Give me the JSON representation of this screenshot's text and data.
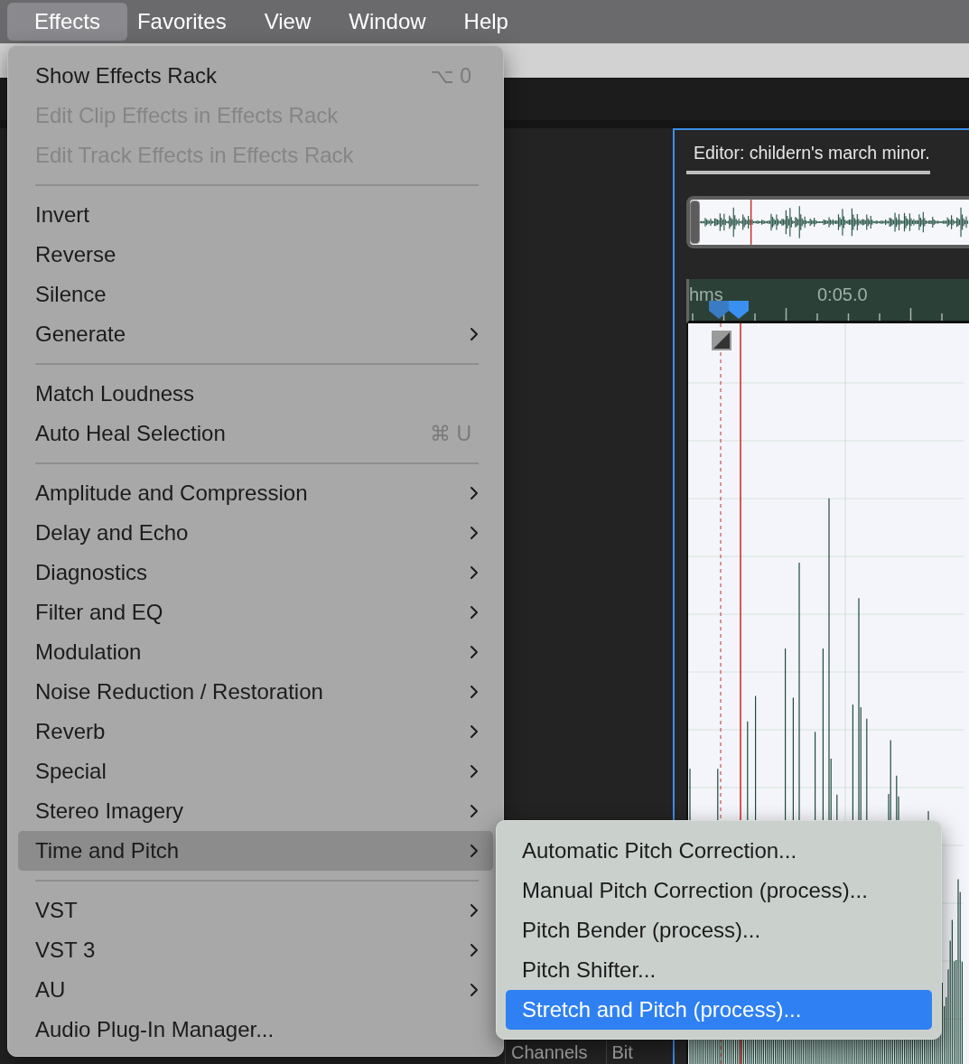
{
  "menu_bar": {
    "items": [
      {
        "label": "Effects",
        "selected": true
      },
      {
        "label": "Favorites",
        "selected": false
      },
      {
        "label": "View",
        "selected": false
      },
      {
        "label": "Window",
        "selected": false
      },
      {
        "label": "Help",
        "selected": false
      }
    ]
  },
  "effects_menu": {
    "items": [
      {
        "kind": "item",
        "label": "Show Effects Rack",
        "shortcut": "⌥ 0",
        "disabled": false,
        "submenu": false,
        "selected": false
      },
      {
        "kind": "item",
        "label": "Edit Clip Effects in Effects Rack",
        "disabled": true,
        "submenu": false,
        "selected": false
      },
      {
        "kind": "item",
        "label": "Edit Track Effects in Effects Rack",
        "disabled": true,
        "submenu": false,
        "selected": false
      },
      {
        "kind": "separator"
      },
      {
        "kind": "item",
        "label": "Invert",
        "disabled": false,
        "submenu": false,
        "selected": false
      },
      {
        "kind": "item",
        "label": "Reverse",
        "disabled": false,
        "submenu": false,
        "selected": false
      },
      {
        "kind": "item",
        "label": "Silence",
        "disabled": false,
        "submenu": false,
        "selected": false
      },
      {
        "kind": "item",
        "label": "Generate",
        "disabled": false,
        "submenu": true,
        "selected": false
      },
      {
        "kind": "separator"
      },
      {
        "kind": "item",
        "label": "Match Loudness",
        "disabled": false,
        "submenu": false,
        "selected": false
      },
      {
        "kind": "item",
        "label": "Auto Heal Selection",
        "shortcut": "⌘ U",
        "disabled": false,
        "submenu": false,
        "selected": false
      },
      {
        "kind": "separator"
      },
      {
        "kind": "item",
        "label": "Amplitude and Compression",
        "disabled": false,
        "submenu": true,
        "selected": false
      },
      {
        "kind": "item",
        "label": "Delay and Echo",
        "disabled": false,
        "submenu": true,
        "selected": false
      },
      {
        "kind": "item",
        "label": "Diagnostics",
        "disabled": false,
        "submenu": true,
        "selected": false
      },
      {
        "kind": "item",
        "label": "Filter and EQ",
        "disabled": false,
        "submenu": true,
        "selected": false
      },
      {
        "kind": "item",
        "label": "Modulation",
        "disabled": false,
        "submenu": true,
        "selected": false
      },
      {
        "kind": "item",
        "label": "Noise Reduction / Restoration",
        "disabled": false,
        "submenu": true,
        "selected": false
      },
      {
        "kind": "item",
        "label": "Reverb",
        "disabled": false,
        "submenu": true,
        "selected": false
      },
      {
        "kind": "item",
        "label": "Special",
        "disabled": false,
        "submenu": true,
        "selected": false
      },
      {
        "kind": "item",
        "label": "Stereo Imagery",
        "disabled": false,
        "submenu": true,
        "selected": false
      },
      {
        "kind": "item",
        "label": "Time and Pitch",
        "disabled": false,
        "submenu": true,
        "selected": true
      },
      {
        "kind": "separator"
      },
      {
        "kind": "item",
        "label": "VST",
        "disabled": false,
        "submenu": true,
        "selected": false
      },
      {
        "kind": "item",
        "label": "VST 3",
        "disabled": false,
        "submenu": true,
        "selected": false
      },
      {
        "kind": "item",
        "label": "AU",
        "disabled": false,
        "submenu": true,
        "selected": false
      },
      {
        "kind": "item",
        "label": "Audio Plug-In Manager...",
        "disabled": false,
        "submenu": false,
        "selected": false
      }
    ]
  },
  "time_and_pitch_submenu": {
    "items": [
      {
        "label": "Automatic Pitch Correction...",
        "selected": false
      },
      {
        "label": "Manual Pitch Correction (process)...",
        "selected": false
      },
      {
        "label": "Pitch Bender (process)...",
        "selected": false
      },
      {
        "label": "Pitch Shifter...",
        "selected": false
      },
      {
        "label": "Stretch and Pitch (process)...",
        "selected": true
      }
    ]
  },
  "editor": {
    "title": "Editor: childern's march minor.",
    "ruler_labels": [
      "hms",
      "0:05.0"
    ]
  },
  "file_columns": [
    "Channels",
    "Bit"
  ]
}
